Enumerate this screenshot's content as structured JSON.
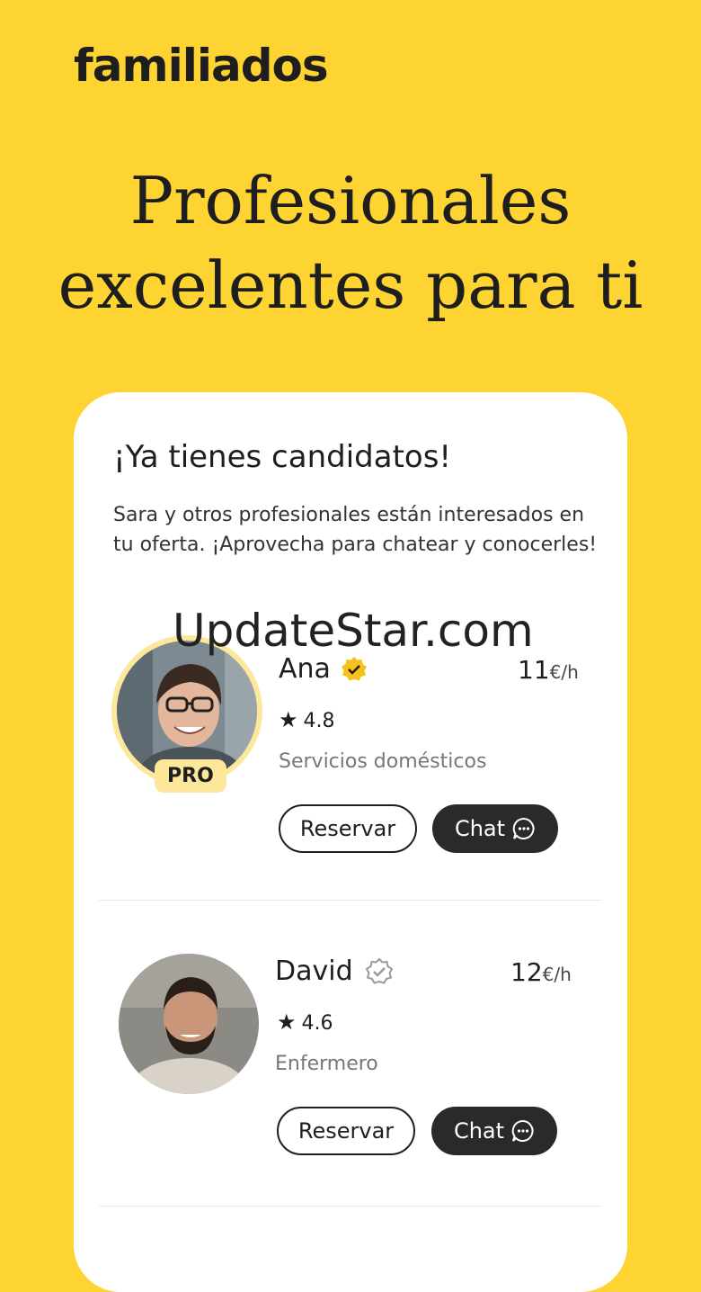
{
  "brand": {
    "logo_text": "familiados"
  },
  "headline": {
    "line1": "Profesionales",
    "line2": "excelentes para ti"
  },
  "card": {
    "title": "¡Ya tienes candidatos!",
    "text": "Sara y otros profesionales están interesados en tu oferta. ¡Aprovecha para chatear y conocerles!",
    "watermark": "UpdateStar.com"
  },
  "candidates": [
    {
      "name": "Ana",
      "verified": true,
      "price": "11",
      "price_unit": "€/h",
      "rating": "4.8",
      "service": "Servicios domésticos",
      "badge": "PRO",
      "reserve_label": "Reservar",
      "chat_label": "Chat"
    },
    {
      "name": "David",
      "verified": false,
      "price": "12",
      "price_unit": "€/h",
      "rating": "4.6",
      "service": "Enfermero",
      "reserve_label": "Reservar",
      "chat_label": "Chat"
    }
  ],
  "colors": {
    "background": "#FDD431",
    "card": "#FFFFFF",
    "pro_badge": "#FCE79B",
    "dark_button": "#2A2A2A",
    "verified_gold": "#F4C21A"
  }
}
